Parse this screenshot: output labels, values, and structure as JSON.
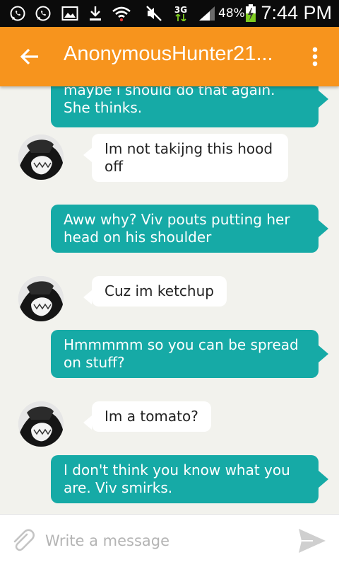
{
  "status_bar": {
    "icons": [
      "whatsapp-icon",
      "whatsapp-icon",
      "gallery-icon",
      "download-icon",
      "wifi-icon",
      "mute-icon",
      "network-3g-icon",
      "signal-icon",
      "battery-charging-icon"
    ],
    "network_type": "3G",
    "battery": "48%",
    "time": "7:44 PM"
  },
  "app_bar": {
    "title": "AnonymousHunter21...",
    "back_icon": "arrow-left-icon",
    "menu_icon": "more-vert-icon",
    "background_color": "#f7941d"
  },
  "messages": [
    {
      "direction": "outgoing",
      "text": "maybe i should do that again. She thinks."
    },
    {
      "direction": "incoming",
      "text": "Im not takijng this hood off"
    },
    {
      "direction": "outgoing",
      "text": "Aww why? Viv pouts putting her head on his shoulder"
    },
    {
      "direction": "incoming",
      "text": "Cuz im ketchup"
    },
    {
      "direction": "outgoing",
      "text": "Hmmmmm so you can be spread on stuff?"
    },
    {
      "direction": "incoming",
      "text": "Im a tomato?"
    },
    {
      "direction": "outgoing",
      "text": "I don't think you know what you are. Viv smirks."
    }
  ],
  "colors": {
    "outgoing_bubble": "#16aaa6",
    "incoming_bubble": "#ffffff",
    "chat_background": "#f2f2ed"
  },
  "composer": {
    "placeholder": "Write a message",
    "value": "",
    "attach_icon": "paperclip-icon",
    "send_icon": "send-icon"
  }
}
